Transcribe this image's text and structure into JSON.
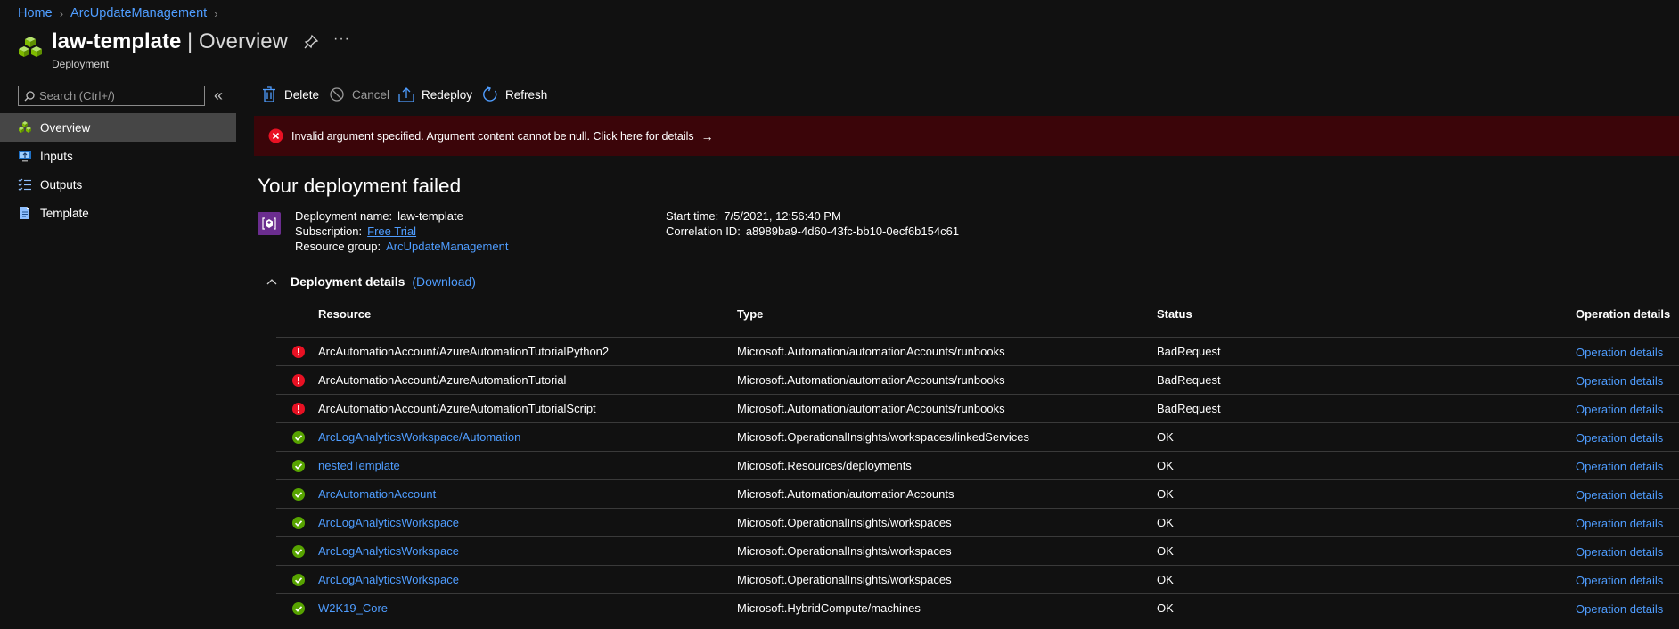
{
  "breadcrumb": {
    "home": "Home",
    "parent": "ArcUpdateManagement"
  },
  "header": {
    "resource_name": "law-template",
    "separator": "|",
    "section": "Overview",
    "subtitle": "Deployment",
    "more": "···"
  },
  "sidebar": {
    "search_placeholder": "Search (Ctrl+/)",
    "collapse": "«",
    "items": [
      {
        "label": "Overview",
        "icon": "overview-icon"
      },
      {
        "label": "Inputs",
        "icon": "inputs-icon"
      },
      {
        "label": "Outputs",
        "icon": "outputs-icon"
      },
      {
        "label": "Template",
        "icon": "template-icon"
      }
    ]
  },
  "toolbar": {
    "delete": "Delete",
    "cancel": "Cancel",
    "redeploy": "Redeploy",
    "refresh": "Refresh"
  },
  "error_banner": {
    "message": "Invalid argument specified. Argument content cannot be null. Click here for details",
    "arrow": "→"
  },
  "deployment": {
    "status_title": "Your deployment failed",
    "name_label": "Deployment name:",
    "name_value": "law-template",
    "subscription_label": "Subscription:",
    "subscription_value": "Free Trial",
    "resource_group_label": "Resource group:",
    "resource_group_value": "ArcUpdateManagement",
    "start_time_label": "Start time:",
    "start_time_value": "7/5/2021, 12:56:40 PM",
    "correlation_label": "Correlation ID:",
    "correlation_value": "a8989ba9-4d60-43fc-bb10-0ecf6b154c61"
  },
  "details": {
    "title": "Deployment details",
    "download": "(Download)"
  },
  "table": {
    "headers": {
      "resource": "Resource",
      "type": "Type",
      "status": "Status",
      "operation": "Operation details"
    },
    "rows": [
      {
        "state": "error",
        "resource": "ArcAutomationAccount/AzureAutomationTutorialPython2",
        "type": "Microsoft.Automation/automationAccounts/runbooks",
        "status": "BadRequest",
        "operation": "Operation details"
      },
      {
        "state": "error",
        "resource": "ArcAutomationAccount/AzureAutomationTutorial",
        "type": "Microsoft.Automation/automationAccounts/runbooks",
        "status": "BadRequest",
        "operation": "Operation details"
      },
      {
        "state": "error",
        "resource": "ArcAutomationAccount/AzureAutomationTutorialScript",
        "type": "Microsoft.Automation/automationAccounts/runbooks",
        "status": "BadRequest",
        "operation": "Operation details"
      },
      {
        "state": "ok",
        "resource": "ArcLogAnalyticsWorkspace/Automation",
        "type": "Microsoft.OperationalInsights/workspaces/linkedServices",
        "status": "OK",
        "operation": "Operation details"
      },
      {
        "state": "ok",
        "resource": "nestedTemplate",
        "type": "Microsoft.Resources/deployments",
        "status": "OK",
        "operation": "Operation details"
      },
      {
        "state": "ok",
        "resource": "ArcAutomationAccount",
        "type": "Microsoft.Automation/automationAccounts",
        "status": "OK",
        "operation": "Operation details"
      },
      {
        "state": "ok",
        "resource": "ArcLogAnalyticsWorkspace",
        "type": "Microsoft.OperationalInsights/workspaces",
        "status": "OK",
        "operation": "Operation details"
      },
      {
        "state": "ok",
        "resource": "ArcLogAnalyticsWorkspace",
        "type": "Microsoft.OperationalInsights/workspaces",
        "status": "OK",
        "operation": "Operation details"
      },
      {
        "state": "ok",
        "resource": "ArcLogAnalyticsWorkspace",
        "type": "Microsoft.OperationalInsights/workspaces",
        "status": "OK",
        "operation": "Operation details"
      },
      {
        "state": "ok",
        "resource": "W2K19_Core",
        "type": "Microsoft.HybridCompute/machines",
        "status": "OK",
        "operation": "Operation details"
      }
    ]
  },
  "colors": {
    "background": "#111111",
    "link": "#4f9dff",
    "error_banner": "#3b0509",
    "error": "#e81123",
    "success": "#57a300",
    "active_nav": "#464646"
  }
}
